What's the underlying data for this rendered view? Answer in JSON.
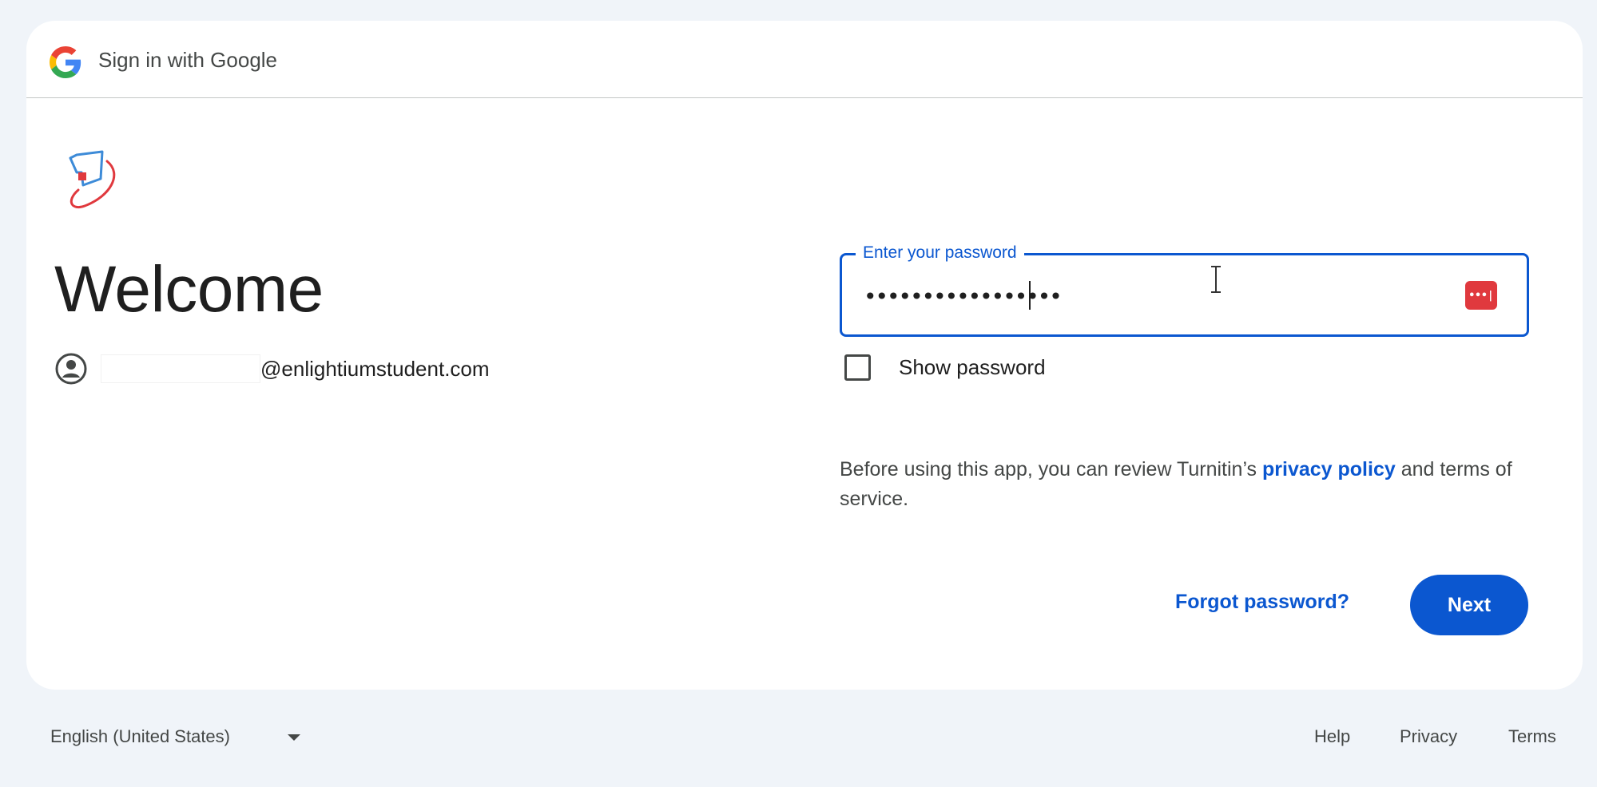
{
  "header": {
    "title": "Sign in with Google"
  },
  "main": {
    "welcome": "Welcome",
    "account_email": "@enlightiumstudent.com"
  },
  "password": {
    "label": "Enter your password",
    "masked_value": "•••••••••••••••••",
    "show_password_label": "Show password",
    "show_password_checked": false
  },
  "policy": {
    "text_before": "Before using this app, you can review Turnitin’s ",
    "privacy_link": "privacy policy",
    "text_after": " and terms of service."
  },
  "actions": {
    "forgot": "Forgot password?",
    "next": "Next"
  },
  "footer": {
    "language": "English (United States)",
    "help": "Help",
    "privacy": "Privacy",
    "terms": "Terms"
  },
  "colors": {
    "accent": "#0b57d0",
    "background": "#f0f4f9",
    "password_manager": "#e0393e"
  }
}
